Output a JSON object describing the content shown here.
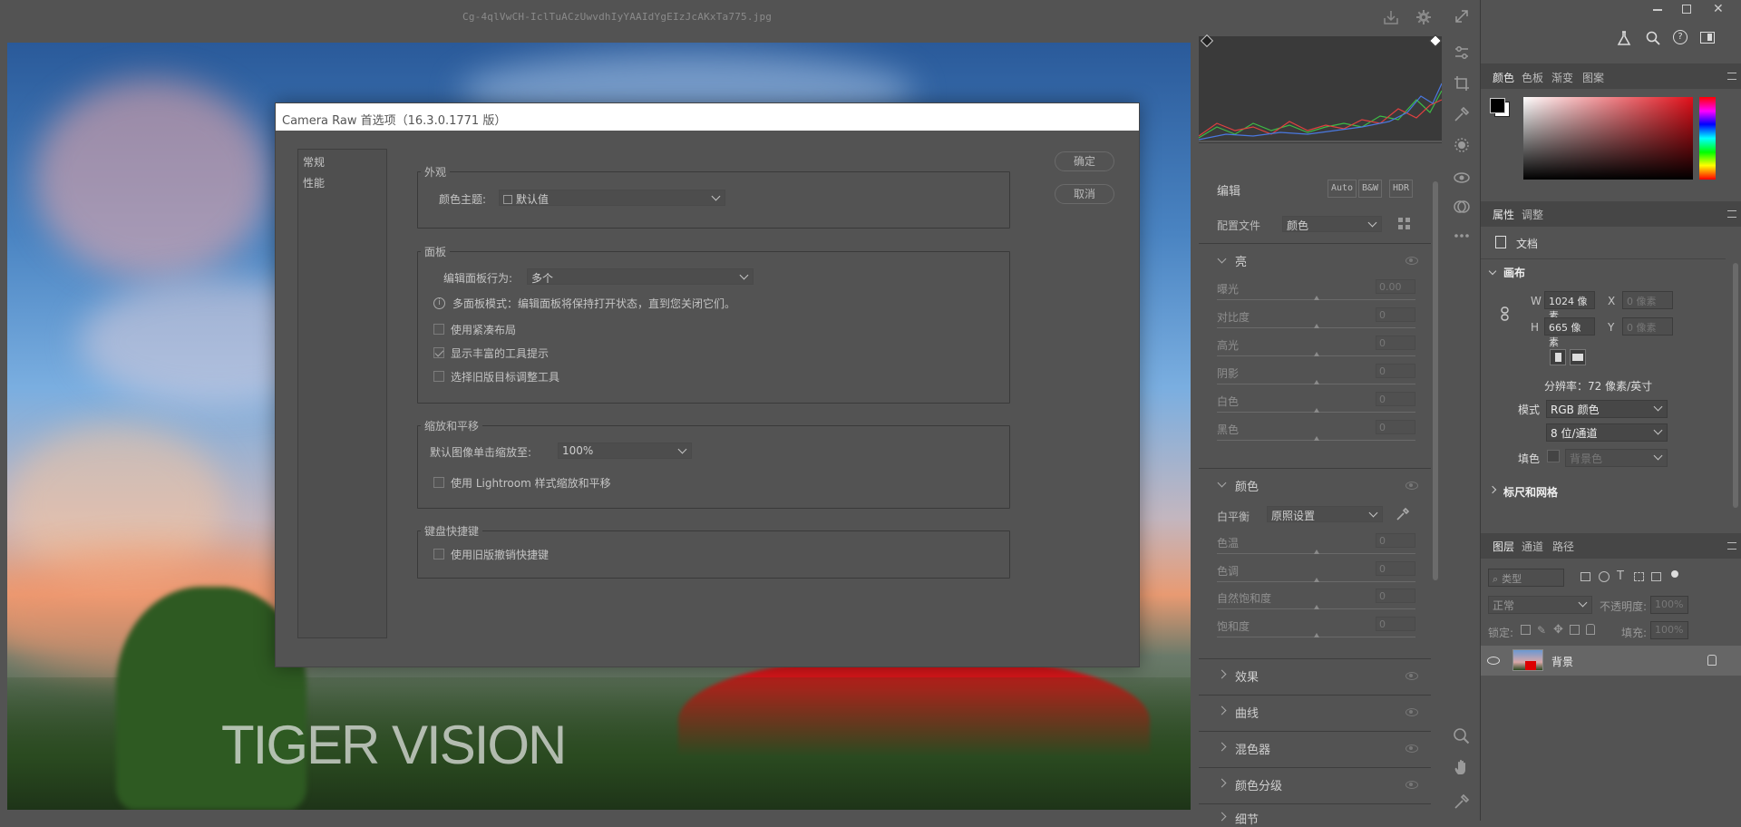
{
  "window": {
    "filename": "Cg-4qlVwCH-IclTuACzUwvdhIyYAAIdYgEIzJcAKxTa775.jpg"
  },
  "canvas": {
    "watermark": "TIGER VISION"
  },
  "dialog": {
    "title": "Camera Raw 首选项（16.3.0.1771 版）",
    "nav": [
      "常规",
      "性能"
    ],
    "ok_label": "确定",
    "cancel_label": "取消",
    "appearance": {
      "title": "外观",
      "theme_label": "颜色主题:",
      "theme_value": "默认值"
    },
    "panels": {
      "title": "面板",
      "behavior_label": "编辑面板行为:",
      "behavior_value": "多个",
      "info_text": "多面板模式：编辑面板将保持打开状态，直到您关闭它们。",
      "compact_label": "使用紧凑布局",
      "tooltips_label": "显示丰富的工具提示",
      "legacy_target_label": "选择旧版目标调整工具"
    },
    "zoom": {
      "title": "缩放和平移",
      "default_label": "默认图像单击缩放至:",
      "default_value": "100%",
      "lightroom_label": "使用 Lightroom 样式缩放和平移"
    },
    "keyboard": {
      "title": "键盘快捷键",
      "legacy_undo_label": "使用旧版撤销快捷键"
    }
  },
  "camera_raw": {
    "edit_title": "编辑",
    "auto": "Auto",
    "bw": "B&W",
    "hdr": "HDR",
    "profile_label": "配置文件",
    "profile_value": "颜色",
    "light": {
      "title": "亮",
      "sliders": [
        {
          "label": "曝光",
          "value": "0.00"
        },
        {
          "label": "对比度",
          "value": "0"
        },
        {
          "label": "高光",
          "value": "0"
        },
        {
          "label": "阴影",
          "value": "0"
        },
        {
          "label": "白色",
          "value": "0"
        },
        {
          "label": "黑色",
          "value": "0"
        }
      ]
    },
    "color": {
      "title": "颜色",
      "wb_label": "白平衡",
      "wb_value": "原照设置",
      "sliders": [
        {
          "label": "色温",
          "value": "0"
        },
        {
          "label": "色调",
          "value": "0"
        },
        {
          "label": "自然饱和度",
          "value": "0"
        },
        {
          "label": "饱和度",
          "value": "0"
        }
      ]
    },
    "collapsed": [
      "效果",
      "曲线",
      "混色器",
      "颜色分级",
      "细节"
    ]
  },
  "ps_panels": {
    "color_tabs": [
      "颜色",
      "色板",
      "渐变",
      "图案"
    ],
    "props_tabs": [
      "属性",
      "调整"
    ],
    "doc_label": "文档",
    "canvas_title": "画布",
    "w_label": "W",
    "w_value": "1024 像素",
    "h_label": "H",
    "h_value": "665 像素",
    "x_label": "X",
    "x_value": "0 像素",
    "y_label": "Y",
    "y_value": "0 像素",
    "resolution": "分辨率：72 像素/英寸",
    "mode_label": "模式",
    "mode_value": "RGB 颜色",
    "depth_value": "8 位/通道",
    "fill_label": "填色",
    "fill_value": "背景色",
    "rulers_title": "标尺和网格",
    "layer_tabs": [
      "图层",
      "通道",
      "路径"
    ],
    "filter_placeholder": "类型",
    "blend_value": "正常",
    "opacity_label": "不透明度:",
    "opacity_value": "100%",
    "lock_label": "锁定:",
    "fill2_label": "填充:",
    "fill2_value": "100%",
    "layer_name": "背景"
  },
  "colors": {
    "accent": "#3b7fd4",
    "dialog_title_bg": "#ffffff",
    "panel_bg": "#535353"
  }
}
